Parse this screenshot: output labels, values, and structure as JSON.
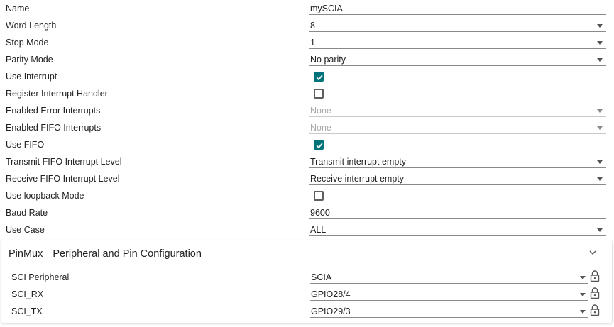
{
  "properties": [
    {
      "label": "Name",
      "type": "text",
      "value": "mySCIA"
    },
    {
      "label": "Word Length",
      "type": "select",
      "value": "8"
    },
    {
      "label": "Stop Mode",
      "type": "select",
      "value": "1"
    },
    {
      "label": "Parity Mode",
      "type": "select",
      "value": "No parity"
    },
    {
      "label": "Use Interrupt",
      "type": "checkbox",
      "checked": true
    },
    {
      "label": "Register Interrupt Handler",
      "type": "checkbox",
      "checked": false
    },
    {
      "label": "Enabled Error Interrupts",
      "type": "select",
      "value": "None",
      "disabled": true
    },
    {
      "label": "Enabled FIFO Interrupts",
      "type": "select",
      "value": "None",
      "disabled": true
    },
    {
      "label": "Use FIFO",
      "type": "checkbox",
      "checked": true
    },
    {
      "label": "Transmit FIFO Interrupt Level",
      "type": "select",
      "value": "Transmit interrupt empty"
    },
    {
      "label": "Receive FIFO Interrupt Level",
      "type": "select",
      "value": "Receive interrupt empty"
    },
    {
      "label": "Use loopback Mode",
      "type": "checkbox",
      "checked": false
    },
    {
      "label": "Baud Rate",
      "type": "text",
      "value": "9600"
    },
    {
      "label": "Use Case",
      "type": "select",
      "value": "ALL"
    }
  ],
  "pinmux": {
    "title": "PinMux",
    "subtitle": "Peripheral and Pin Configuration",
    "expand_icon": "chevron-down-icon",
    "rows": [
      {
        "label": "SCI Peripheral",
        "value": "SCIA",
        "lock_icon": "lock-icon"
      },
      {
        "label": "SCI_RX",
        "value": "GPIO28/4",
        "lock_icon": "lock-icon"
      },
      {
        "label": "SCI_TX",
        "value": "GPIO29/3",
        "lock_icon": "lock-icon"
      }
    ]
  },
  "colors": {
    "checkbox_checked": "#00737a",
    "text": "#212121",
    "disabled_text": "#a8a8a8",
    "underline": "#8a8a8a"
  }
}
